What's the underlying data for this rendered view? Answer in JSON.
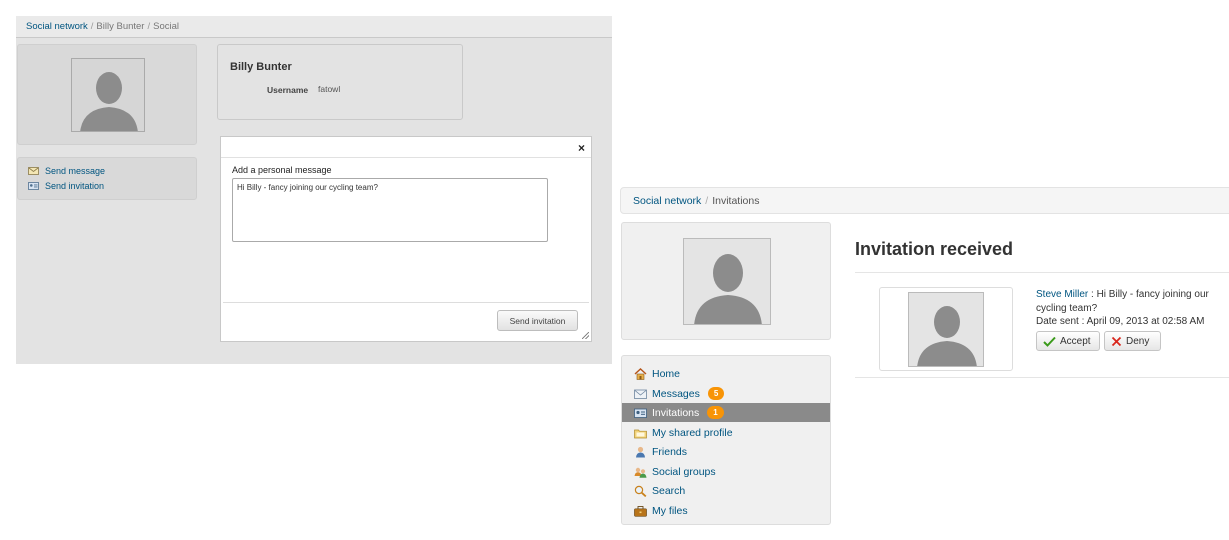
{
  "left_screen": {
    "breadcrumb": [
      "Social network",
      "Billy Bunter",
      "Social"
    ],
    "profile": {
      "name": "Billy Bunter",
      "username_label": "Username",
      "username_value": "fatowl"
    },
    "actions": [
      {
        "label": "Send message",
        "icon": "pencil-envelope-icon"
      },
      {
        "label": "Send invitation",
        "icon": "contact-card-icon"
      }
    ],
    "modal": {
      "close_glyph": "×",
      "label": "Add a personal message",
      "message": "Hi Billy - fancy joining our cycling team?",
      "send_label": "Send invitation"
    }
  },
  "right_screen": {
    "breadcrumb": [
      "Social network",
      "Invitations"
    ],
    "menu": [
      {
        "label": "Home",
        "icon": "home-icon"
      },
      {
        "label": "Messages",
        "icon": "envelope-icon",
        "badge": "5"
      },
      {
        "label": "Invitations",
        "icon": "contact-card-icon",
        "badge": "1",
        "active": true
      },
      {
        "label": "My shared profile",
        "icon": "folder-icon"
      },
      {
        "label": "Friends",
        "icon": "user-icon"
      },
      {
        "label": "Social groups",
        "icon": "group-icon"
      },
      {
        "label": "Search",
        "icon": "magnifier-icon"
      },
      {
        "label": "My files",
        "icon": "briefcase-icon"
      }
    ],
    "title": "Invitation received",
    "invitation": {
      "sender": "Steve Miller",
      "message": " : Hi Billy - fancy joining our cycling team?",
      "date_sent": "Date sent : April 09, 2013 at 02:58 AM",
      "accept_label": "Accept",
      "deny_label": "Deny"
    }
  },
  "colors": {
    "link": "#005580",
    "badge": "#f89406",
    "active_menu": "#8a8a8a",
    "accept_check": "#3a9a1a",
    "deny_x": "#d9261c"
  }
}
